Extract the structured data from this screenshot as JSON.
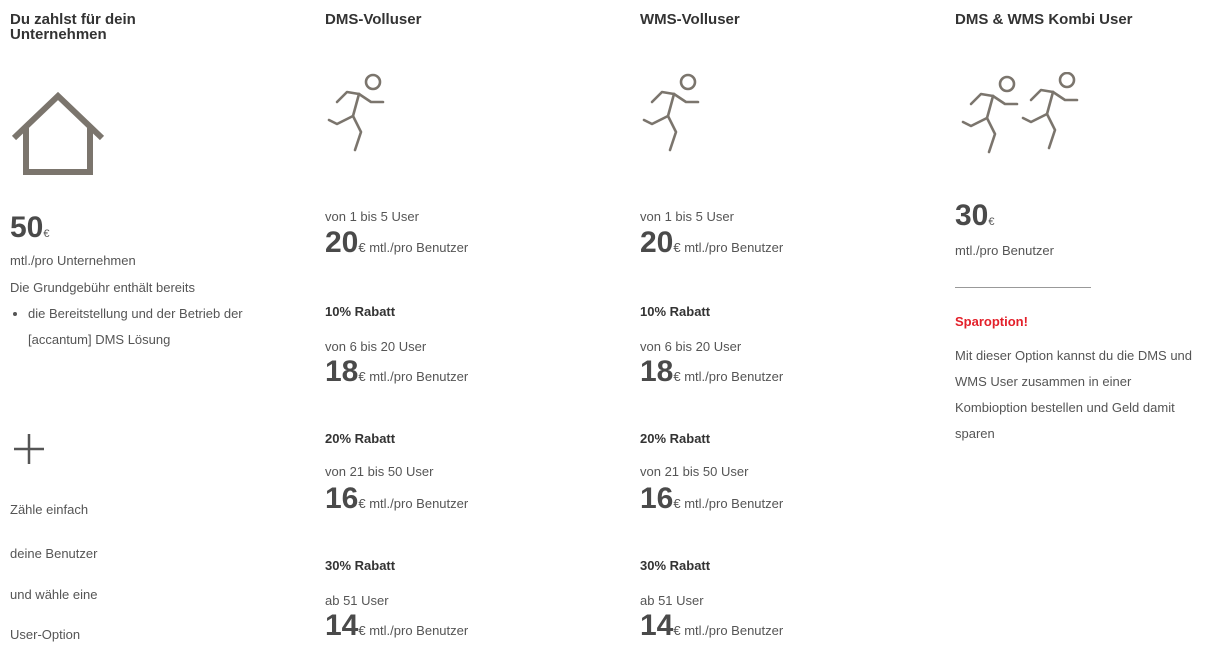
{
  "columns": [
    {
      "heading": "Du zahlst für dein Unternehmen",
      "icon": "house-icon",
      "price": "50",
      "currency": "€",
      "price_unit": "mtl./pro Unternehmen",
      "intro": "Die Grundgebühr enthält bereits",
      "features": [
        "die Bereitstellung und der Betrieb der [accantum] DMS Lösung"
      ],
      "plus_icon": "plus-icon",
      "closing": [
        "Zähle einfach",
        "deine Benutzer",
        "und wähle eine",
        "User-Option"
      ]
    },
    {
      "heading": "DMS-Volluser",
      "icon": "runner-icon",
      "tiers": [
        {
          "discount": "",
          "range": "von 1 bis 5 User",
          "price": "20",
          "unit": "€ mtl./pro Benutzer"
        },
        {
          "discount": "10% Rabatt",
          "range": "von 6 bis 20 User",
          "price": "18",
          "unit": "€ mtl./pro Benutzer"
        },
        {
          "discount": "20% Rabatt",
          "range": "von 21 bis 50 User",
          "price": "16",
          "unit": "€ mtl./pro Benutzer"
        },
        {
          "discount": "30% Rabatt",
          "range": "ab 51 User",
          "price": "14",
          "unit": "€ mtl./pro Benutzer"
        }
      ]
    },
    {
      "heading": "WMS-Volluser",
      "icon": "runner-icon",
      "tiers": [
        {
          "discount": "",
          "range": "von 1 bis 5 User",
          "price": "20",
          "unit": "€ mtl./pro Benutzer"
        },
        {
          "discount": "10% Rabatt",
          "range": "von 6 bis 20 User",
          "price": "18",
          "unit": "€ mtl./pro Benutzer"
        },
        {
          "discount": "20% Rabatt",
          "range": "von 21 bis 50 User",
          "price": "16",
          "unit": "€ mtl./pro Benutzer"
        },
        {
          "discount": "30% Rabatt",
          "range": "ab 51 User",
          "price": "14",
          "unit": "€ mtl./pro Benutzer"
        }
      ]
    },
    {
      "heading": "DMS & WMS Kombi User",
      "icon": "two-runners-icon",
      "price": "30",
      "currency": "€",
      "price_unit": "mtl./pro Benutzer",
      "highlight": "Sparoption!",
      "description": "Mit dieser Option kannst du die DMS und WMS User zusammen in einer Kombioption bestellen und Geld damit sparen"
    }
  ],
  "colors": {
    "highlight": "#e3202a",
    "icon_stroke": "#7b756d",
    "heading": "#333333"
  }
}
